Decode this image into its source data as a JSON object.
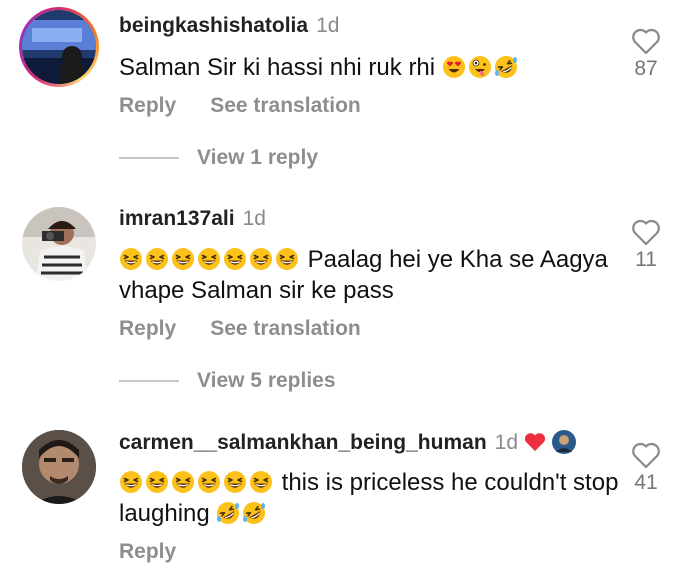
{
  "comments": [
    {
      "username": "beingkashishatolia",
      "time": "1d",
      "text": "Salman Sir ki hassi nhi ruk rhi ",
      "text_emojis": [
        "heart-eyes-emoji",
        "zany-face-emoji",
        "rolling-laughing-emoji"
      ],
      "actions": [
        "Reply",
        "See translation"
      ],
      "replies_label": "View 1 reply",
      "likes": "87",
      "has_story_ring": true
    },
    {
      "username": "imran137ali",
      "time": "1d",
      "lead_emojis": [
        "grinning-squint-emoji",
        "grinning-squint-emoji",
        "grinning-squint-emoji",
        "grinning-squint-emoji",
        "grinning-squint-emoji",
        "grinning-squint-emoji",
        "grinning-squint-emoji"
      ],
      "text": " Paalag hei ye Kha se Aagya vhape  Salman sir ke  pass",
      "actions": [
        "Reply",
        "See translation"
      ],
      "replies_label": "View 5 replies",
      "likes": "11"
    },
    {
      "username": "carmen__salmankhan_being_human",
      "time": "1d",
      "badges": [
        "red-heart-icon",
        "creator-liked-avatar"
      ],
      "lead_emojis": [
        "grinning-squint-emoji",
        "grinning-squint-emoji",
        "grinning-squint-emoji",
        "grinning-squint-emoji",
        "grinning-squint-emoji",
        "grinning-squint-emoji"
      ],
      "text": " this is priceless he couldn't stop laughing ",
      "trail_emojis": [
        "rolling-laughing-emoji",
        "rolling-laughing-emoji"
      ],
      "actions": [
        "Reply"
      ],
      "likes": "41"
    }
  ],
  "colors": {
    "secondary_text": "#8e8e8e",
    "primary_text": "#111111",
    "heart_red": "#ed2e3e"
  }
}
